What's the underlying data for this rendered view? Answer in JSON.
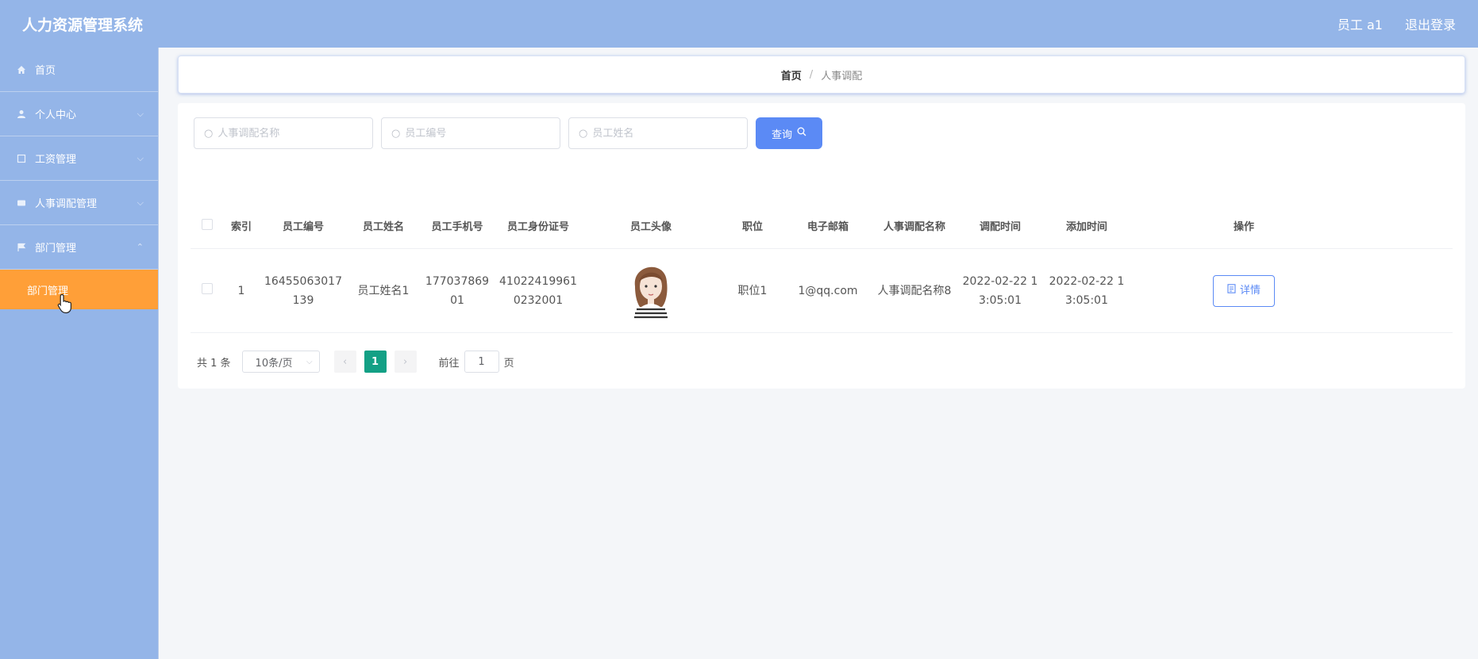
{
  "header": {
    "title": "人力资源管理系统",
    "user": "员工 a1",
    "logout": "退出登录"
  },
  "sidebar": {
    "items": [
      {
        "label": "首页",
        "icon": "home-icon",
        "has_children": false
      },
      {
        "label": "个人中心",
        "icon": "user-icon",
        "has_children": true
      },
      {
        "label": "工资管理",
        "icon": "salary-icon",
        "has_children": true
      },
      {
        "label": "人事调配管理",
        "icon": "transfer-icon",
        "has_children": true
      },
      {
        "label": "部门管理",
        "icon": "flag-icon",
        "has_children": true
      }
    ],
    "active_sub": "部门管理"
  },
  "breadcrumb": {
    "home": "首页",
    "separator": "/",
    "current": "人事调配"
  },
  "search": {
    "field1_placeholder": "人事调配名称",
    "field2_placeholder": "员工编号",
    "field3_placeholder": "员工姓名",
    "button": "查询"
  },
  "table": {
    "headers": [
      "索引",
      "员工编号",
      "员工姓名",
      "员工手机号",
      "员工身份证号",
      "员工头像",
      "职位",
      "电子邮箱",
      "人事调配名称",
      "调配时间",
      "添加时间",
      "操作"
    ],
    "rows": [
      {
        "index": "1",
        "emp_no": "16455063017139",
        "name": "员工姓名1",
        "phone": "17703786901",
        "id_card": "410224199610232001",
        "position": "职位1",
        "email": "1@qq.com",
        "transfer_name": "人事调配名称8",
        "transfer_time": "2022-02-22 13:05:01",
        "add_time": "2022-02-22 13:05:01",
        "action": "详情"
      }
    ]
  },
  "pagination": {
    "total": "共 1 条",
    "page_size": "10条/页",
    "current_page": "1",
    "goto_prefix": "前往",
    "goto_value": "1",
    "goto_suffix": "页"
  },
  "colors": {
    "header_bg": "#94b5e8",
    "active_menu": "#ff9f38",
    "primary": "#5b8af5",
    "page_active": "#13a085"
  }
}
